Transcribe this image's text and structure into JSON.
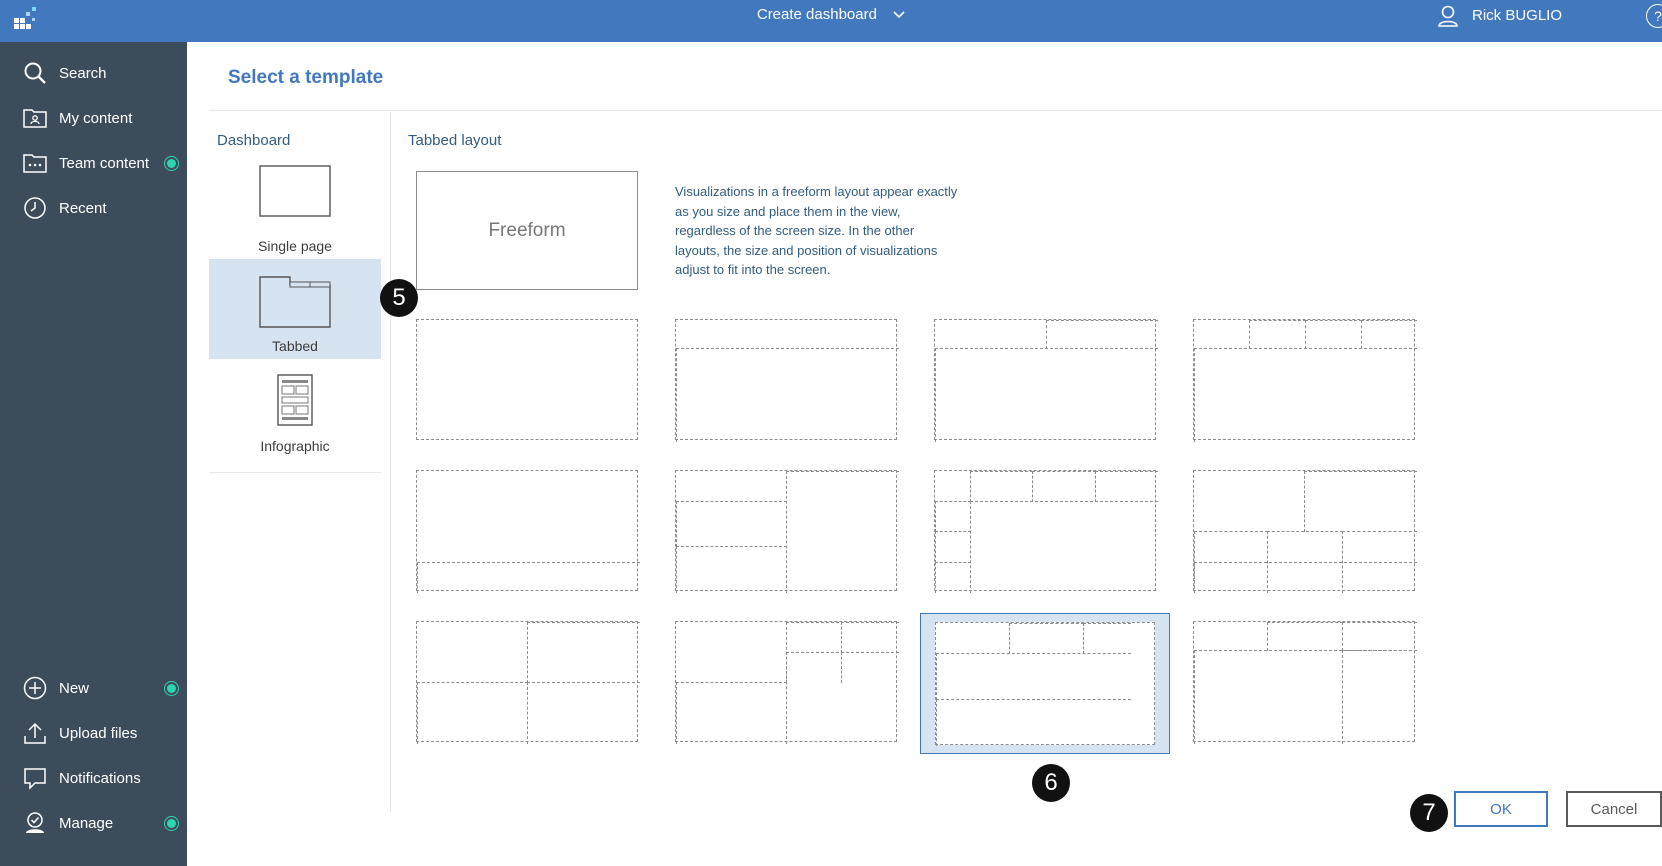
{
  "header": {
    "title": "Create dashboard",
    "user_name": "Rick BUGLIO",
    "help_label": "?"
  },
  "sidebar": {
    "items_top": [
      {
        "label": "Search",
        "icon": "search-icon"
      },
      {
        "label": "My content",
        "icon": "folder-user-icon"
      },
      {
        "label": "Team content",
        "icon": "folder-team-icon",
        "indicator": true
      },
      {
        "label": "Recent",
        "icon": "clock-icon"
      }
    ],
    "items_bottom": [
      {
        "label": "New",
        "icon": "plus-circle-icon",
        "indicator": true
      },
      {
        "label": "Upload files",
        "icon": "upload-icon"
      },
      {
        "label": "Notifications",
        "icon": "chat-icon"
      },
      {
        "label": "Manage",
        "icon": "manage-icon",
        "indicator": true
      }
    ]
  },
  "main": {
    "page_title": "Select a template",
    "left_section_label": "Dashboard",
    "layout_options": [
      {
        "label": "Single page",
        "selected": false
      },
      {
        "label": "Tabbed",
        "selected": true
      },
      {
        "label": "Infographic",
        "selected": false
      }
    ],
    "right_section_label": "Tabbed layout",
    "freeform_label": "Freeform",
    "freeform_description": "Visualizations in a freeform layout appear exactly as you size and place them in the view, regardless of the screen size. In the other layouts, the size and position of visualizations adjust to fit into the screen.",
    "selected_template_index": 10
  },
  "callouts": {
    "c5": "5",
    "c6": "6",
    "c7": "7"
  },
  "actions": {
    "ok_label": "OK",
    "cancel_label": "Cancel"
  },
  "colors": {
    "header_bg": "#4178be",
    "sidebar_bg": "#3d4c5a",
    "accent": "#4178be",
    "selected_bg": "#d6e3f1",
    "indicator": "#2fd4b0"
  }
}
